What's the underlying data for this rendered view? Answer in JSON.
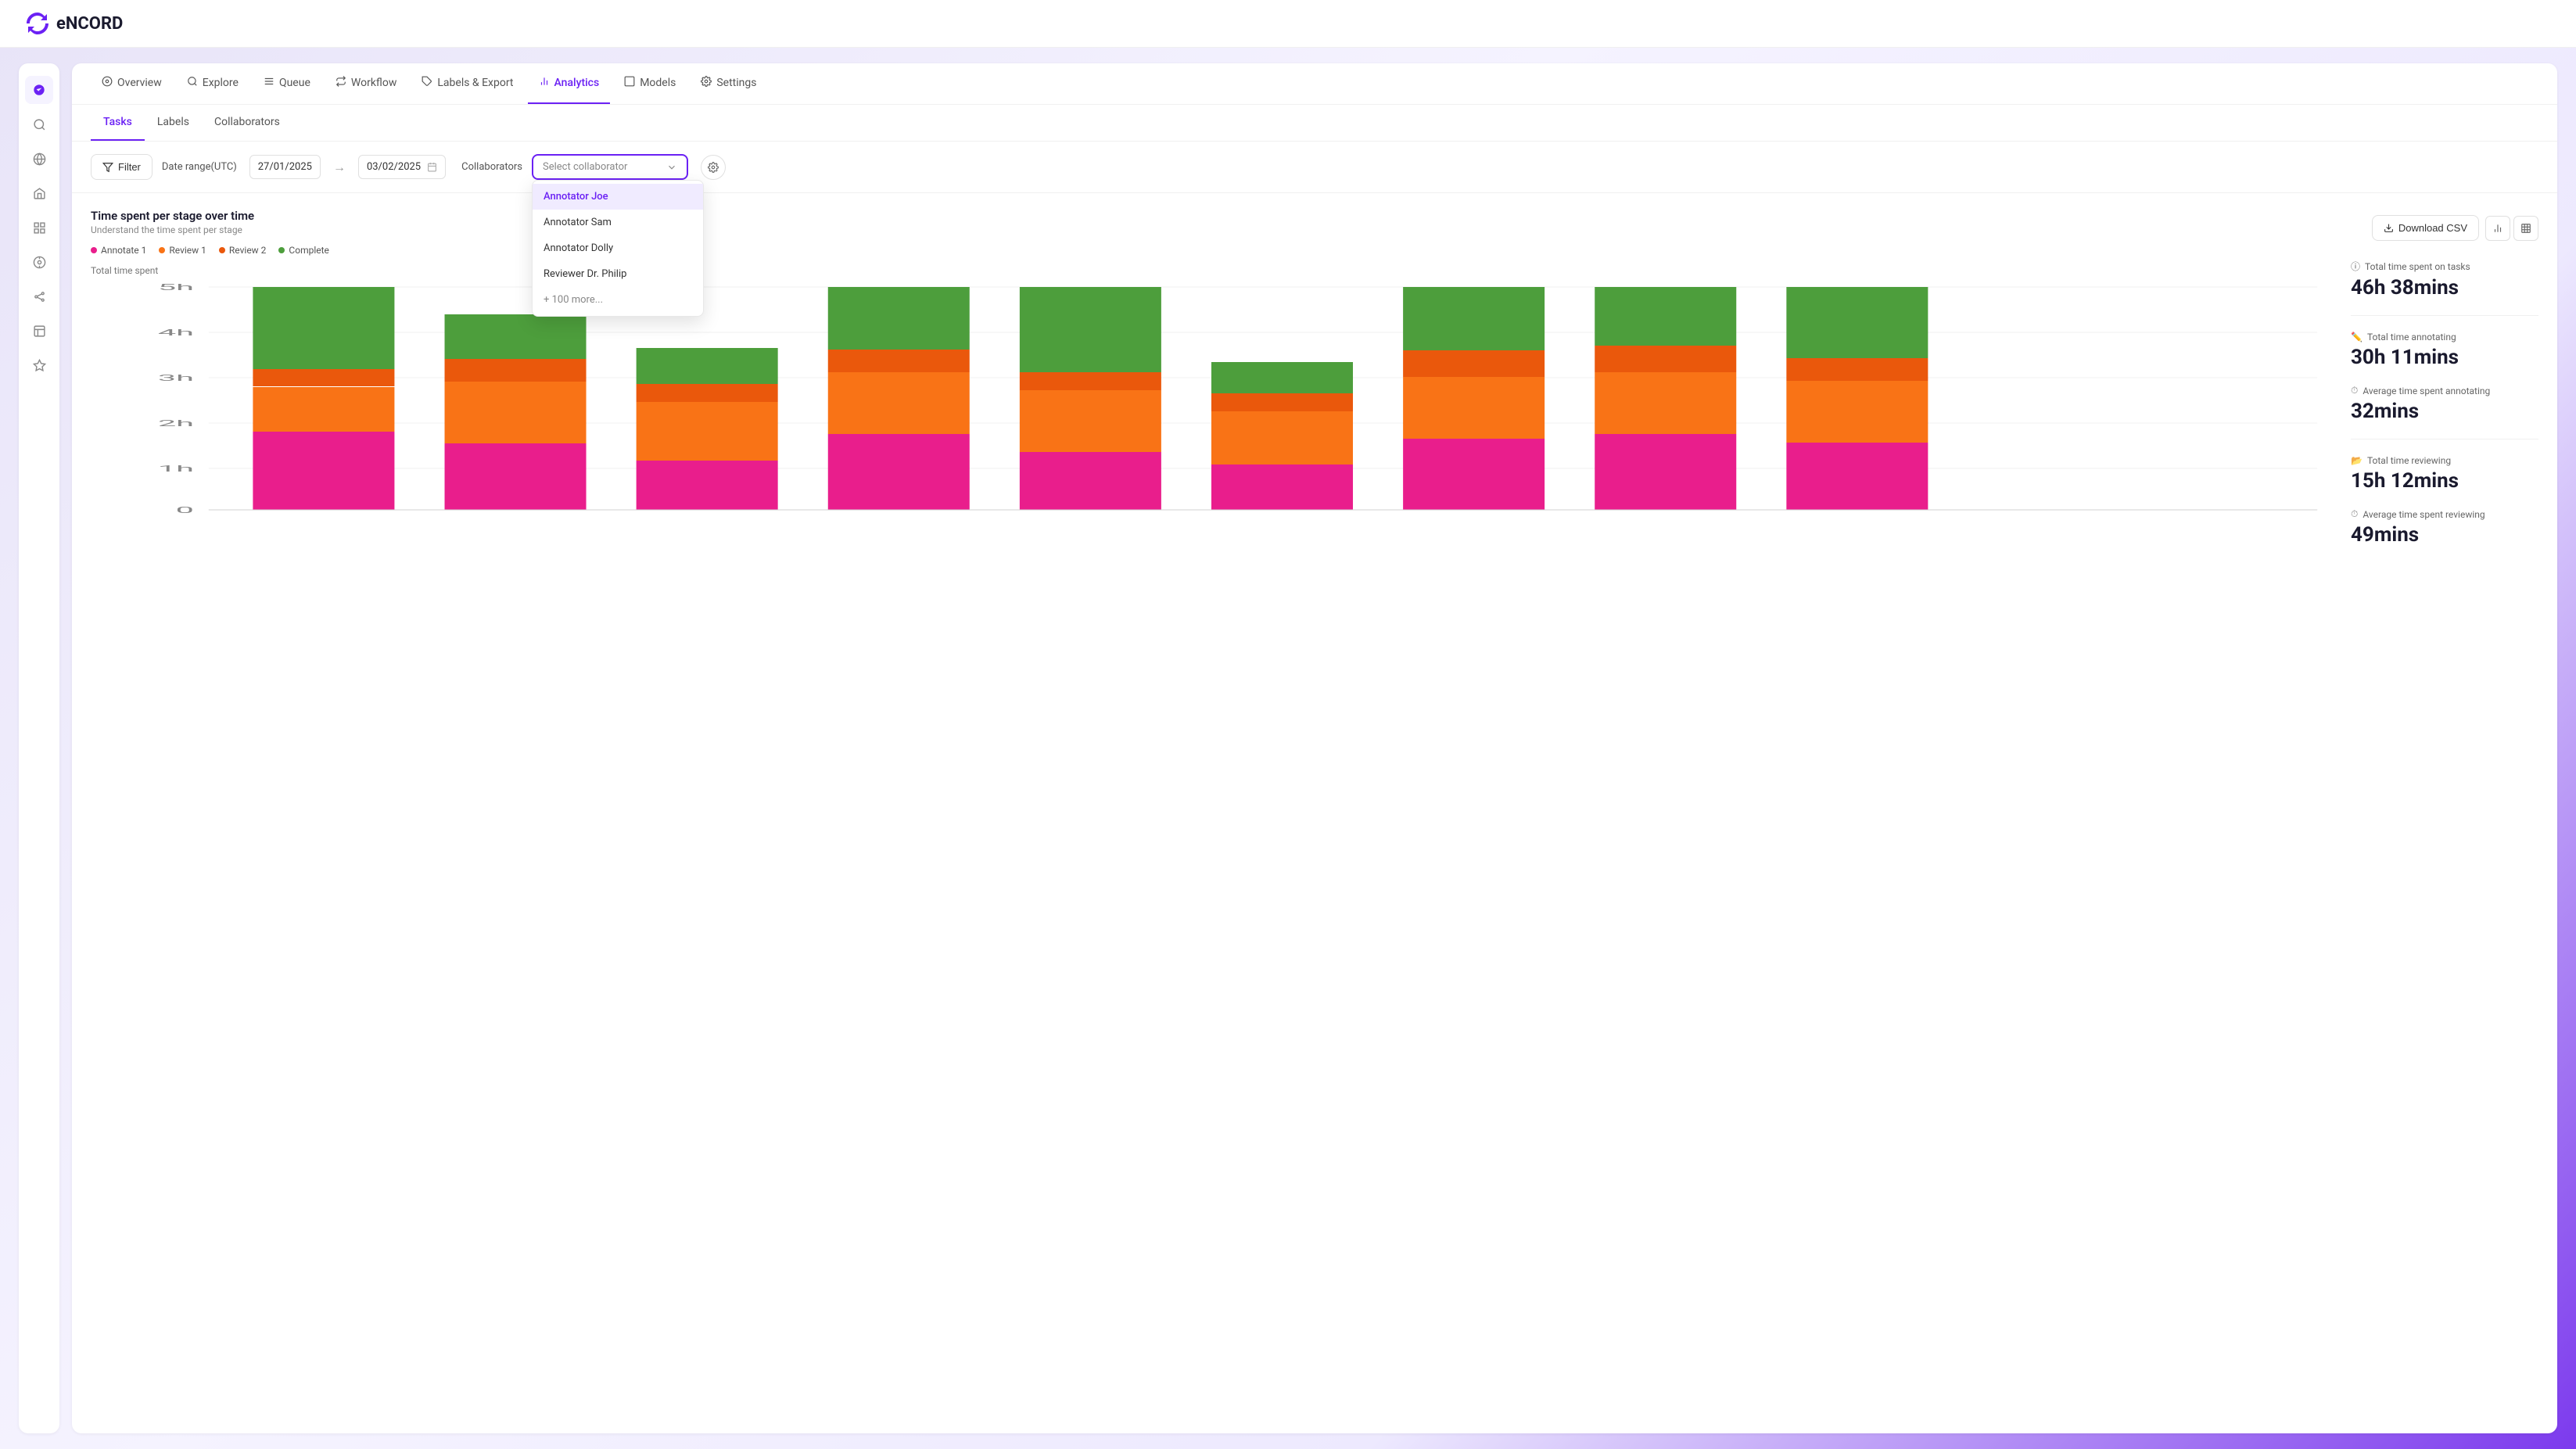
{
  "app": {
    "title": "eNCORD",
    "logo_text": "eNCORD"
  },
  "nav": {
    "tabs": [
      {
        "id": "overview",
        "label": "Overview",
        "icon": "⊙",
        "active": false
      },
      {
        "id": "explore",
        "label": "Explore",
        "icon": "🔍",
        "active": false
      },
      {
        "id": "queue",
        "label": "Queue",
        "icon": "☰",
        "active": false
      },
      {
        "id": "workflow",
        "label": "Workflow",
        "icon": "⟳",
        "active": false
      },
      {
        "id": "labels-export",
        "label": "Labels & Export",
        "icon": "🏷",
        "active": false
      },
      {
        "id": "analytics",
        "label": "Analytics",
        "icon": "📊",
        "active": true
      },
      {
        "id": "models",
        "label": "Models",
        "icon": "⬜",
        "active": false
      },
      {
        "id": "settings",
        "label": "Settings",
        "icon": "⚙",
        "active": false
      }
    ]
  },
  "sub_tabs": [
    {
      "id": "tasks",
      "label": "Tasks",
      "active": true
    },
    {
      "id": "labels",
      "label": "Labels",
      "active": false
    },
    {
      "id": "collaborators",
      "label": "Collaborators",
      "active": false
    }
  ],
  "filter_bar": {
    "filter_label": "Filter",
    "date_range_label": "Date range(UTC)",
    "date_from": "27/01/2025",
    "date_to": "03/02/2025",
    "collaborators_label": "Collaborators",
    "select_placeholder": "Select collaborator"
  },
  "collaborator_dropdown": {
    "options": [
      {
        "id": "joe",
        "label": "Annotator Joe",
        "highlighted": true
      },
      {
        "id": "sam",
        "label": "Annotator Sam",
        "highlighted": false
      },
      {
        "id": "dolly",
        "label": "Annotator Dolly",
        "highlighted": false
      },
      {
        "id": "philip",
        "label": "Reviewer Dr. Philip",
        "highlighted": false
      }
    ],
    "more_label": "+ 100 more..."
  },
  "chart": {
    "title": "Time spent per stage over time",
    "subtitle": "Understand the time spent per stage",
    "y_label": "Total time spent",
    "y_axis": [
      "5h",
      "4h",
      "3h",
      "2h",
      "1h",
      "0"
    ],
    "legend": [
      {
        "id": "annotate1",
        "label": "Annotate 1",
        "color": "#e91e8c"
      },
      {
        "id": "review1",
        "label": "Review 1",
        "color": "#f97316"
      },
      {
        "id": "review2",
        "label": "Review 2",
        "color": "#f97316"
      },
      {
        "id": "complete",
        "label": "Complete",
        "color": "#4d9e3c"
      }
    ],
    "bars": [
      {
        "annotate1": 35,
        "review1": 20,
        "review2": 8,
        "complete": 37
      },
      {
        "annotate1": 30,
        "review1": 28,
        "review2": 10,
        "complete": 20
      },
      {
        "annotate1": 22,
        "review1": 26,
        "review2": 8,
        "complete": 16
      },
      {
        "annotate1": 34,
        "review1": 28,
        "review2": 10,
        "complete": 28
      },
      {
        "annotate1": 26,
        "review1": 28,
        "review2": 8,
        "complete": 38
      },
      {
        "annotate1": 20,
        "review1": 24,
        "review2": 8,
        "complete": 14
      },
      {
        "annotate1": 32,
        "review1": 28,
        "review2": 12,
        "complete": 28
      },
      {
        "annotate1": 34,
        "review1": 28,
        "review2": 12,
        "complete": 26
      },
      {
        "annotate1": 30,
        "review1": 24,
        "review2": 10,
        "complete": 36
      }
    ],
    "download_label": "Download CSV"
  },
  "stats": [
    {
      "id": "total-time",
      "icon": "ⓘ",
      "label": "Total time spent on tasks",
      "value": "46h 38mins",
      "color": "#555"
    },
    {
      "id": "annotating",
      "icon": "✏",
      "label": "Total time annotating",
      "value": "30h 11mins",
      "color": "#e91e8c"
    },
    {
      "id": "avg-annotating",
      "icon": "⏱",
      "label": "Average time spent annotating",
      "value": "32mins",
      "color": "#888"
    },
    {
      "id": "reviewing",
      "icon": "📁",
      "label": "Total time reviewing",
      "value": "15h 12mins",
      "color": "#f97316"
    },
    {
      "id": "avg-reviewing",
      "icon": "⏱",
      "label": "Average time spent reviewing",
      "value": "49mins",
      "color": "#888"
    }
  ],
  "sidebar": {
    "icons": [
      {
        "id": "logo",
        "icon": "✦",
        "active": true
      },
      {
        "id": "search",
        "icon": "🔍",
        "active": false
      },
      {
        "id": "globe",
        "icon": "🌐",
        "active": false
      },
      {
        "id": "home",
        "icon": "⌂",
        "active": false
      },
      {
        "id": "grid",
        "icon": "⊞",
        "active": false
      },
      {
        "id": "target",
        "icon": "◎",
        "active": false
      },
      {
        "id": "share",
        "icon": "⋈",
        "active": false
      },
      {
        "id": "box",
        "icon": "⬡",
        "active": false
      },
      {
        "id": "badge",
        "icon": "◈",
        "active": false
      }
    ]
  }
}
